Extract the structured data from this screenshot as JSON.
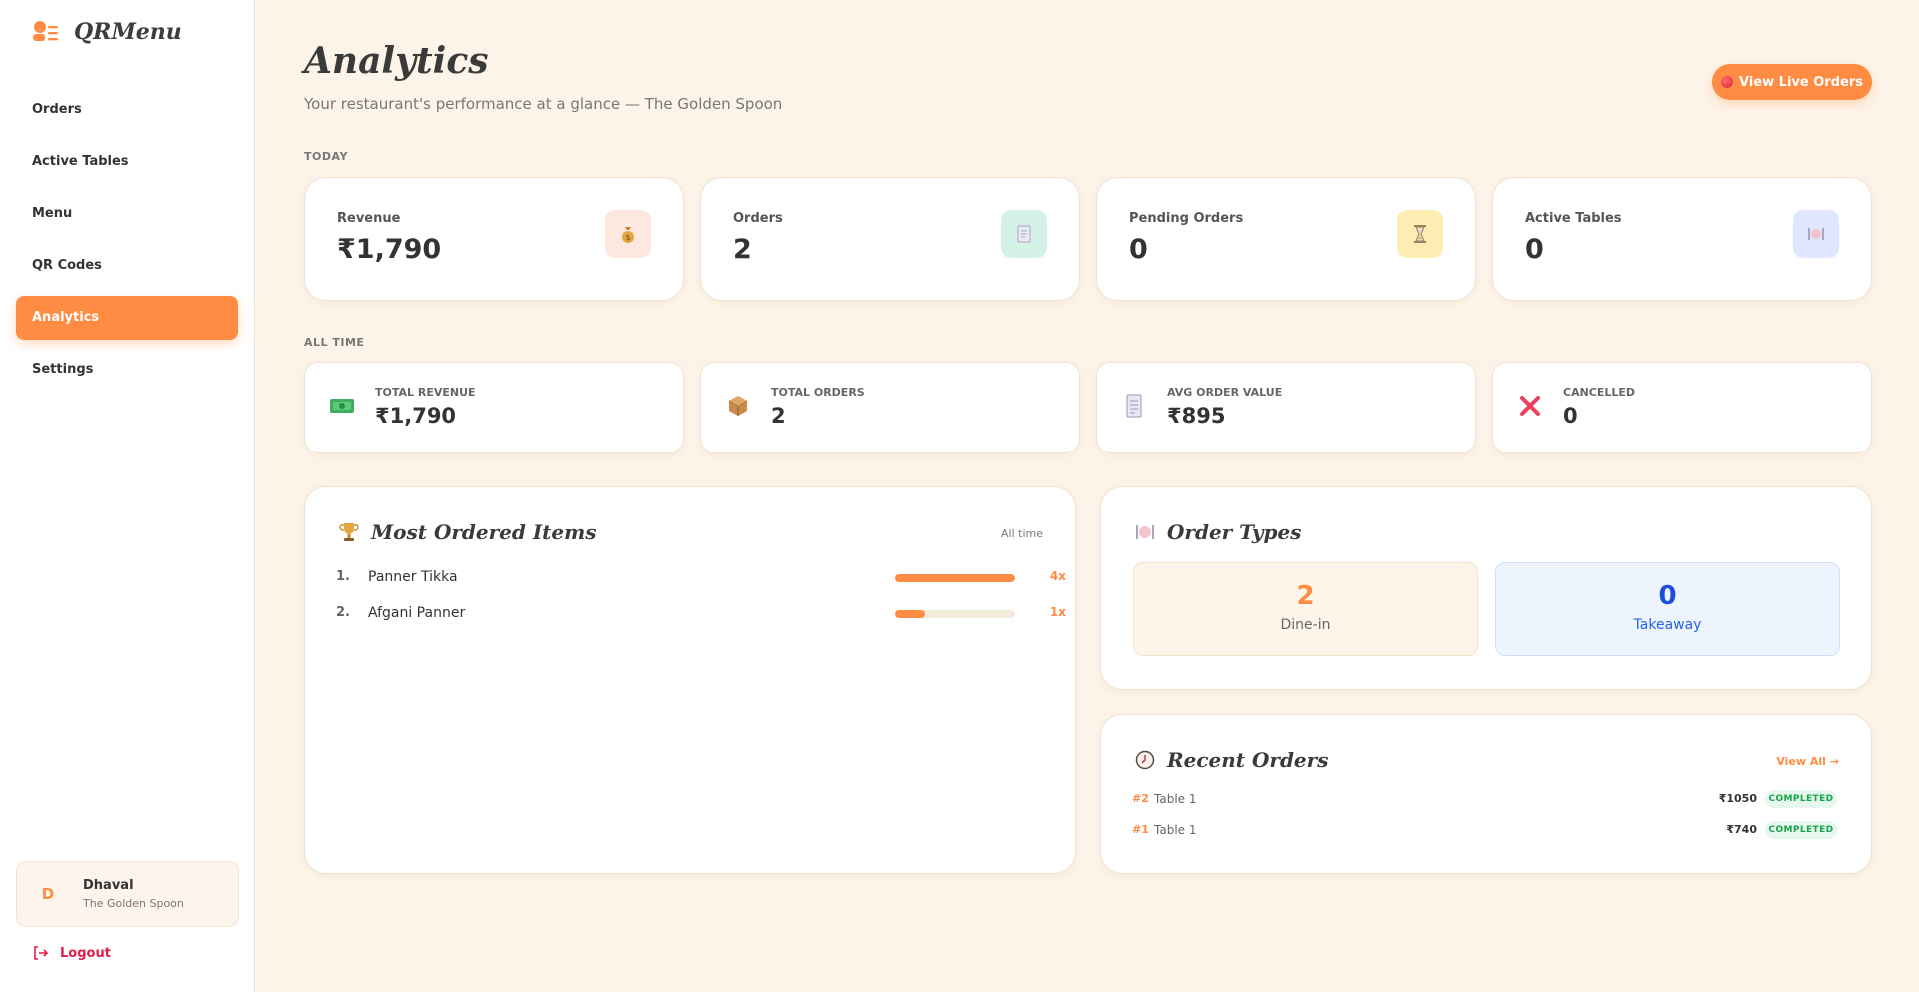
{
  "brand": {
    "name": "QRMenu"
  },
  "nav": {
    "items": [
      {
        "label": "Orders"
      },
      {
        "label": "Active Tables"
      },
      {
        "label": "Menu"
      },
      {
        "label": "QR Codes"
      },
      {
        "label": "Analytics",
        "active": true
      },
      {
        "label": "Settings"
      }
    ]
  },
  "user": {
    "initial": "D",
    "name": "Dhaval",
    "restaurant": "The Golden Spoon",
    "logout_label": "Logout"
  },
  "header": {
    "title": "Analytics",
    "subtitle": "Your restaurant's performance at a glance — The Golden Spoon",
    "live_button": "View Live Orders"
  },
  "today": {
    "section_label": "TODAY",
    "cards": [
      {
        "label": "Revenue",
        "value": "₹1,790",
        "icon": "money-bag-icon",
        "icon_bg": "#fde8df"
      },
      {
        "label": "Orders",
        "value": "2",
        "icon": "receipt-icon",
        "icon_bg": "#d3f2e5"
      },
      {
        "label": "Pending Orders",
        "value": "0",
        "icon": "hourglass-icon",
        "icon_bg": "#fdedb2"
      },
      {
        "label": "Active Tables",
        "value": "0",
        "icon": "dining-icon",
        "icon_bg": "#dfe6fd"
      }
    ]
  },
  "all_time": {
    "section_label": "ALL TIME",
    "cards": [
      {
        "label": "TOTAL REVENUE",
        "value": "₹1,790",
        "icon": "banknote-icon"
      },
      {
        "label": "TOTAL ORDERS",
        "value": "2",
        "icon": "package-icon"
      },
      {
        "label": "AVG ORDER VALUE",
        "value": "₹895",
        "icon": "receipt-icon"
      },
      {
        "label": "CANCELLED",
        "value": "0",
        "icon": "cross-icon"
      }
    ]
  },
  "most_ordered": {
    "title": "Most Ordered Items",
    "filter": "All time",
    "items": [
      {
        "rank": "1.",
        "name": "Panner Tikka",
        "count": "4x",
        "share": 1.0
      },
      {
        "rank": "2.",
        "name": "Afgani Panner",
        "count": "1x",
        "share": 0.25
      }
    ]
  },
  "order_types": {
    "title": "Order Types",
    "dine_in": {
      "value": "2",
      "label": "Dine-in"
    },
    "takeaway": {
      "value": "0",
      "label": "Takeaway"
    }
  },
  "recent_orders": {
    "title": "Recent Orders",
    "view_all": "View All →",
    "orders": [
      {
        "id": "#2",
        "table": "Table 1",
        "amount": "₹1050",
        "status": "COMPLETED"
      },
      {
        "id": "#1",
        "table": "Table 1",
        "amount": "₹740",
        "status": "COMPLETED"
      }
    ]
  },
  "colors": {
    "accent": "#ff8c42",
    "background": "#fdf4e9",
    "success": "#16a34a",
    "danger": "#e11d48"
  }
}
